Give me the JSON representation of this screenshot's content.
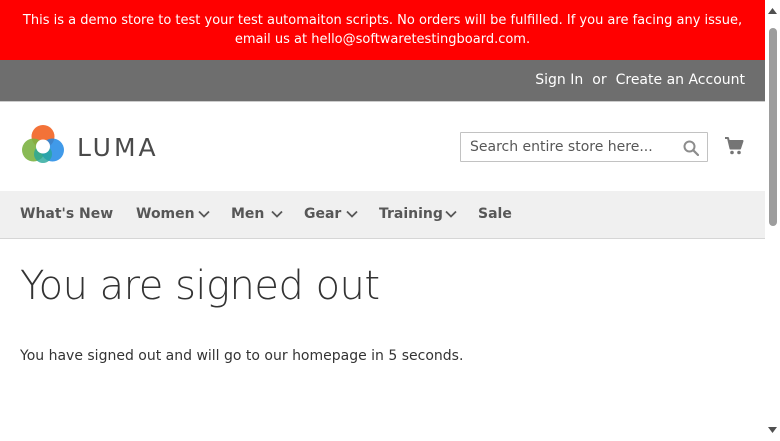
{
  "banner": {
    "text": "This is a demo store to test your test automaiton scripts. No orders will be fulfilled. If you are facing any issue, email us at hello@softwaretestingboard.com."
  },
  "header": {
    "sign_in": "Sign In",
    "or": "or",
    "create_account": "Create an Account"
  },
  "logo": {
    "text": "LUMA"
  },
  "search": {
    "placeholder": "Search entire store here..."
  },
  "nav": {
    "items": [
      {
        "label": "What's New",
        "has_dropdown": false
      },
      {
        "label": "Women",
        "has_dropdown": true
      },
      {
        "label": "Men",
        "has_dropdown": true
      },
      {
        "label": "Gear",
        "has_dropdown": true
      },
      {
        "label": "Training",
        "has_dropdown": true
      },
      {
        "label": "Sale",
        "has_dropdown": false
      }
    ]
  },
  "main": {
    "title": "You are signed out",
    "message": "You have signed out and will go to our homepage in 5 seconds."
  },
  "colors": {
    "banner_bg": "#ff0000",
    "header_panel_bg": "#6e6e6e",
    "nav_bg": "#f0f0f0",
    "logo_orange": "#f26322",
    "logo_green": "#7cb342",
    "logo_blue": "#1e88e5",
    "logo_teal": "#26a69a"
  }
}
